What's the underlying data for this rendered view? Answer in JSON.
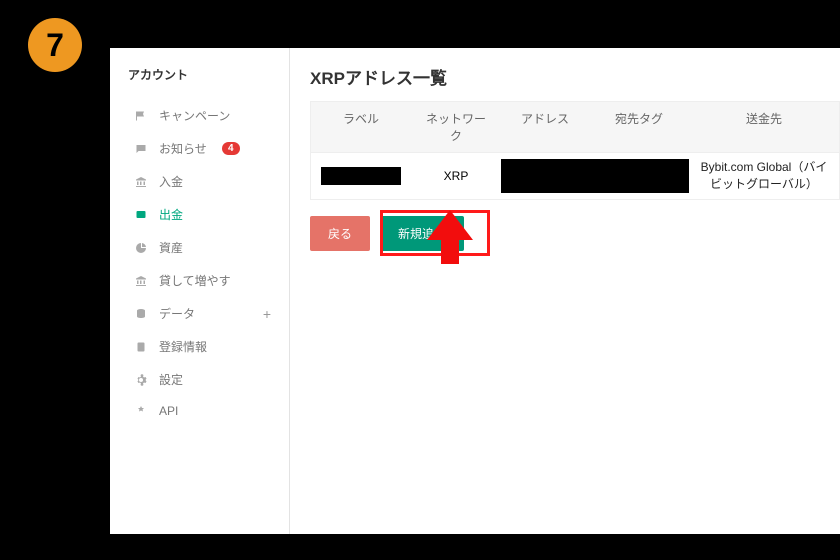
{
  "step": "7",
  "sidebar": {
    "title": "アカウント",
    "items": [
      {
        "label": "キャンペーン"
      },
      {
        "label": "お知らせ",
        "badge": "4"
      },
      {
        "label": "入金"
      },
      {
        "label": "出金"
      },
      {
        "label": "資産"
      },
      {
        "label": "貸して増やす"
      },
      {
        "label": "データ",
        "expandable": true
      },
      {
        "label": "登録情報"
      },
      {
        "label": "設定"
      },
      {
        "label": "API"
      }
    ]
  },
  "main": {
    "title": "XRPアドレス一覧",
    "columns": {
      "label": "ラベル",
      "network": "ネットワーク",
      "address": "アドレス",
      "tag": "宛先タグ",
      "dest": "送金先"
    },
    "row": {
      "network": "XRP",
      "dest": "Bybit.com Global（バイビットグローバル）"
    },
    "buttons": {
      "back": "戻る",
      "add": "新規追加"
    }
  }
}
